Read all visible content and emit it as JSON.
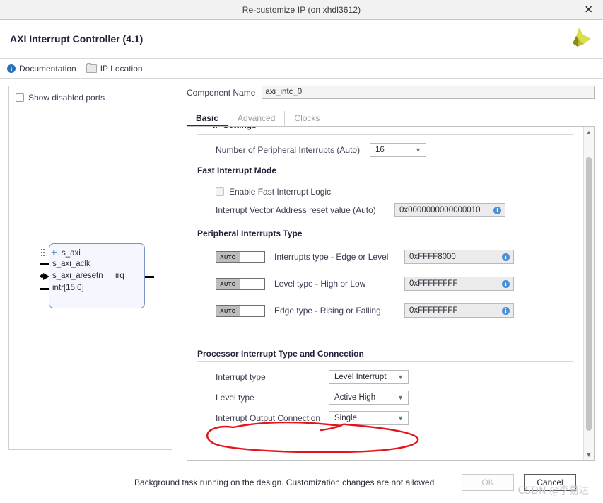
{
  "window": {
    "title": "Re-customize IP (on xhdl3612)",
    "close_icon": "close-icon"
  },
  "header": {
    "ip_title": "AXI Interrupt Controller (4.1)",
    "logo_icon": "vivado-logo-icon"
  },
  "toolbar": {
    "documentation_label": "Documentation",
    "documentation_icon": "info-icon",
    "ip_location_label": "IP Location",
    "ip_location_icon": "folder-icon"
  },
  "left_panel": {
    "show_disabled_ports_label": "Show disabled ports",
    "show_disabled_ports_checked": false,
    "symbol": {
      "ports_in": [
        "s_axi",
        "s_axi_aclk",
        "s_axi_aresetn",
        "intr[15:0]"
      ],
      "ports_out": [
        "irq"
      ]
    }
  },
  "component": {
    "label": "Component Name",
    "value": "axi_intc_0"
  },
  "tabs": [
    {
      "label": "Basic",
      "active": true
    },
    {
      "label": "Advanced",
      "active": false
    },
    {
      "label": "Clocks",
      "active": false
    }
  ],
  "form": {
    "clipped_section_title": "IP Settings",
    "peripheral_count": {
      "label": "Number of Peripheral Interrupts (Auto)",
      "value": "16"
    },
    "fast_interrupt_mode": {
      "title": "Fast Interrupt Mode",
      "enable_fast_logic_label": "Enable Fast Interrupt Logic",
      "enable_fast_logic_checked": false,
      "enable_fast_logic_disabled": true,
      "vector_addr_label": "Interrupt Vector Address reset value (Auto)",
      "vector_addr_value": "0x0000000000000010",
      "info_icon": "info-icon"
    },
    "peripheral_interrupts_type": {
      "title": "Peripheral Interrupts Type",
      "auto_badge": "AUTO",
      "rows": [
        {
          "label": "Interrupts type - Edge or Level",
          "value": "0xFFFF8000",
          "auto": true
        },
        {
          "label": "Level type - High or Low",
          "value": "0xFFFFFFFF",
          "auto": true
        },
        {
          "label": "Edge type - Rising or Falling",
          "value": "0xFFFFFFFF",
          "auto": true
        }
      ]
    },
    "processor_interrupt": {
      "title": "Processor Interrupt Type and Connection",
      "rows": [
        {
          "label": "Interrupt type",
          "value": "Level Interrupt"
        },
        {
          "label": "Level type",
          "value": "Active High"
        },
        {
          "label": "Interrupt Output Connection",
          "value": "Single"
        }
      ]
    }
  },
  "scrollbar": {
    "up_icon": "chevron-up-icon",
    "down_icon": "chevron-down-icon"
  },
  "footer": {
    "message": "Background task running on the design. Customization changes are not allowed",
    "ok_label": "OK",
    "ok_disabled": true,
    "cancel_label": "Cancel"
  },
  "annotation": {
    "color": "#e8121b",
    "shape": "hand-drawn-ellipse"
  },
  "watermark": {
    "text": "CSDN @李易达"
  }
}
